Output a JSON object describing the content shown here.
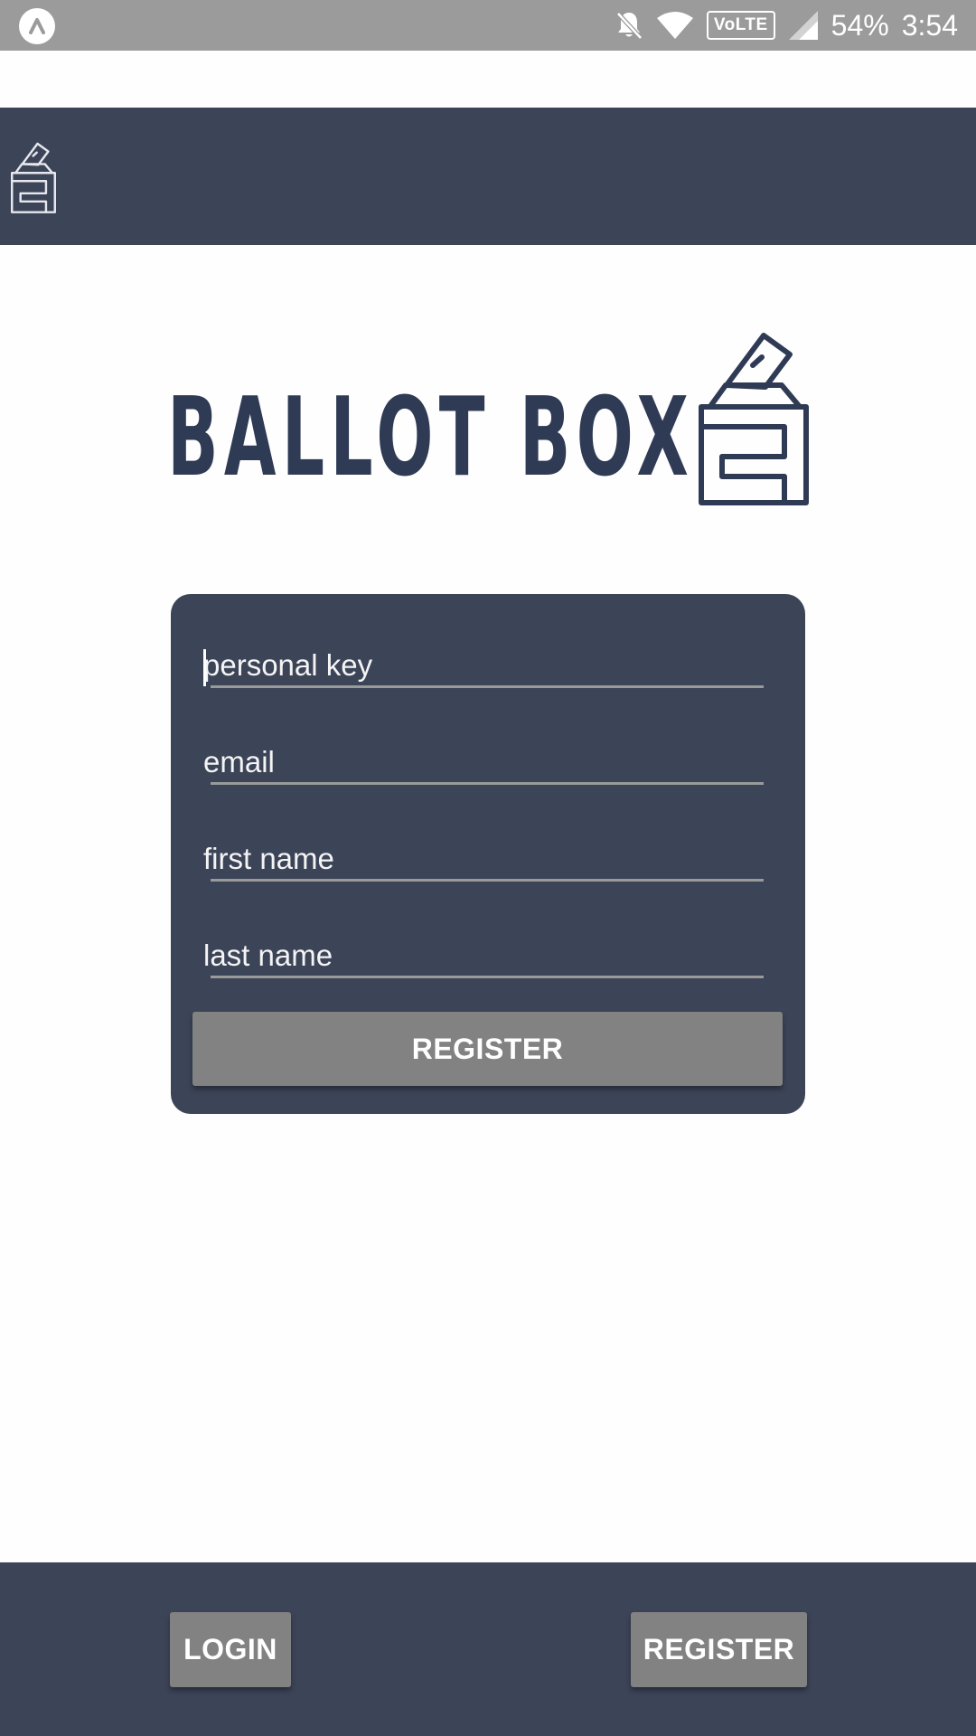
{
  "status_bar": {
    "app_icon": "up-caret-icon",
    "icons": [
      "bell-off-icon",
      "wifi-icon",
      "volte-badge",
      "signal-icon"
    ],
    "volte_label": "VoLTE",
    "battery": "54%",
    "time": "3:54"
  },
  "header": {
    "logo_icon": "ballot-box-icon"
  },
  "brand": {
    "wordmark": "BALLOT BOX",
    "icon": "ballot-box-icon"
  },
  "form": {
    "fields": [
      {
        "name": "personal-key",
        "placeholder": "personal key",
        "value": "",
        "focused": true
      },
      {
        "name": "email",
        "placeholder": "email",
        "value": "",
        "focused": false
      },
      {
        "name": "first-name",
        "placeholder": "first name",
        "value": "",
        "focused": false
      },
      {
        "name": "last-name",
        "placeholder": "last name",
        "value": "",
        "focused": false
      }
    ],
    "submit_label": "REGISTER"
  },
  "bottom_nav": {
    "login_label": "LOGIN",
    "register_label": "REGISTER"
  },
  "colors": {
    "primary": "#3c4458",
    "brand_text": "#2f3b55",
    "button": "#828282",
    "status_bar": "#9b9b9b",
    "background": "#fefefe"
  }
}
